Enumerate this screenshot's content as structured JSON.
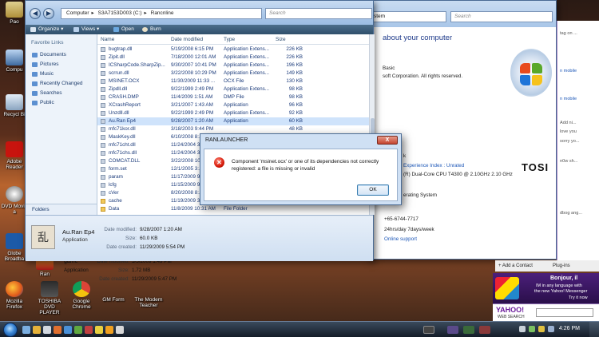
{
  "desktop_icons": [
    {
      "label": "Pao"
    },
    {
      "label": "Compu"
    },
    {
      "label": "Recycl Bi"
    },
    {
      "label": "Adobe Reader"
    },
    {
      "label": "DVD Movie a"
    },
    {
      "label": "Globe Broadba"
    },
    {
      "label": "Ran"
    },
    {
      "label": "Mozilla Firefox"
    },
    {
      "label": "TOSHIBA DVD PLAYER"
    },
    {
      "label": "Google Chrome"
    },
    {
      "label": "GM Form"
    },
    {
      "label": "The Modern Teacher"
    }
  ],
  "explorer": {
    "breadcrumb": [
      "Computer",
      "S3A7153D003 (C:)",
      "Rancnline"
    ],
    "search_placeholder": "Search",
    "toolbar": {
      "organize": "Organize",
      "views": "Views",
      "open": "Open",
      "burn": "Burn"
    },
    "nav": {
      "title": "Favorite Links",
      "links": [
        "Documents",
        "Pictures",
        "Music",
        "Recently Changed",
        "Searches",
        "Public"
      ],
      "folders": "Folders"
    },
    "columns": {
      "name": "Name",
      "date": "Date modified",
      "type": "Type",
      "size": "Size"
    },
    "files": [
      {
        "name": "bugtrap.dll",
        "date": "5/19/2008 6:15 PM",
        "type": "Application Extens...",
        "size": "226 KB"
      },
      {
        "name": "Zipit.dll",
        "date": "7/18/2000 12:01 AM",
        "type": "Application Extens...",
        "size": "226 KB"
      },
      {
        "name": "ICSharpCode.SharpZip...",
        "date": "9/30/2007 10:41 PM",
        "type": "Application Extens...",
        "size": "196 KB"
      },
      {
        "name": "scrrun.dll",
        "date": "3/22/2008 10:29 PM",
        "type": "Application Extens...",
        "size": "149 KB"
      },
      {
        "name": "MSINET.OCX",
        "date": "11/30/2009 11:33 ...",
        "type": "OCX File",
        "size": "130 KB"
      },
      {
        "name": "Zipdll.dll",
        "date": "9/22/1999 2:49 PM",
        "type": "Application Extens...",
        "size": "98 KB"
      },
      {
        "name": "CRASH.DMP",
        "date": "11/4/2009 1:51 AM",
        "type": "DMP File",
        "size": "98 KB"
      },
      {
        "name": "XCrashReport",
        "date": "3/21/2007 1:43 AM",
        "type": "Application",
        "size": "96 KB"
      },
      {
        "name": "Unzdll.dll",
        "date": "9/22/1999 2:49 PM",
        "type": "Application Extens...",
        "size": "92 KB"
      },
      {
        "name": "Au.Ran Ep4",
        "date": "9/28/2007 1:20 AM",
        "type": "Application",
        "size": "60 KB"
      },
      {
        "name": "mfc71kor.dll",
        "date": "3/18/2003 9:44 PM",
        "type": "",
        "size": "48 KB"
      },
      {
        "name": "MaskKey.dll",
        "date": "6/10/2008 8:...",
        "type": "",
        "size": ""
      },
      {
        "name": "mfc71cht.dll",
        "date": "11/24/2004 3:...",
        "type": "",
        "size": ""
      },
      {
        "name": "mfc71chs.dll",
        "date": "11/24/2004 3:...",
        "type": "",
        "size": ""
      },
      {
        "name": "COMCAT.DLL",
        "date": "3/22/2008 10:...",
        "type": "",
        "size": ""
      },
      {
        "name": "form.set",
        "date": "12/1/2005 3:...",
        "type": "",
        "size": ""
      },
      {
        "name": "param",
        "date": "11/17/2009 9:...",
        "type": "",
        "size": ""
      },
      {
        "name": "lcfg",
        "date": "11/15/2009 9:...",
        "type": "",
        "size": ""
      },
      {
        "name": "cVer",
        "date": "8/20/2008 8:...",
        "type": "",
        "size": ""
      },
      {
        "name": "cache",
        "date": "11/19/2009 3:59 AM",
        "type": "File Folder",
        "size": ""
      },
      {
        "name": "Data",
        "date": "11/8/2009 10:31 AM",
        "type": "File Folder",
        "size": ""
      }
    ],
    "details": {
      "name": "Au.Ran Ep4",
      "type": "Application",
      "date_modified_label": "Date modified:",
      "date_modified": "9/28/2007 1:20 AM",
      "size_label": "Size:",
      "size": "60.0 KB",
      "date_created_label": "Date created:",
      "date_created": "11/29/2009 5:54 PM"
    }
  },
  "ghost_details": {
    "name": "game",
    "type": "Application",
    "date_modified_label": "Date modified:",
    "date_modified": "5/5/2009 1:49 PM",
    "size_label": "Size:",
    "size": "1.72 MB",
    "date_created_label": "Date created:",
    "date_created": "11/29/2009 5:47 PM"
  },
  "syswin": {
    "address": "stem",
    "search_placeholder": "Search",
    "heading": "about your computer",
    "lines": [
      "Basic",
      "soft Corporation.  All rights reserved.",
      "k",
      "Experience Index : Unrated",
      "(R) Dual-Core CPU    T4300  @ 2.10GHz   2.10 GHz",
      "erating System",
      "+65-6744-7717",
      "24hrs/day 7days/week",
      "Online support"
    ],
    "brand": "TOSI"
  },
  "messenger": {
    "rows": [
      "tag on ...",
      "n mobile",
      "n mobile",
      "Add ni...",
      "love you",
      "sorry yo...",
      "n0w sh...",
      "dbog ang..."
    ],
    "add_contact": "+ Add a Contact",
    "plugins": "Plug-ins",
    "ad_title": "Bonjour, il",
    "ad_lines": [
      "IM in any language with",
      "the new Yahoo! Messenger",
      "Try it now"
    ],
    "yahoo_logo": "YAHOO!",
    "yahoo_sub": "WEB SEARCH"
  },
  "dialog": {
    "title": "RANLAUNCHER",
    "close": "X",
    "message": "Component 'msinet.ocx' or one of its dependencies not correctly registered: a file is missing or invalid",
    "ok": "OK"
  },
  "taskbar": {
    "time": "4:26 PM"
  }
}
